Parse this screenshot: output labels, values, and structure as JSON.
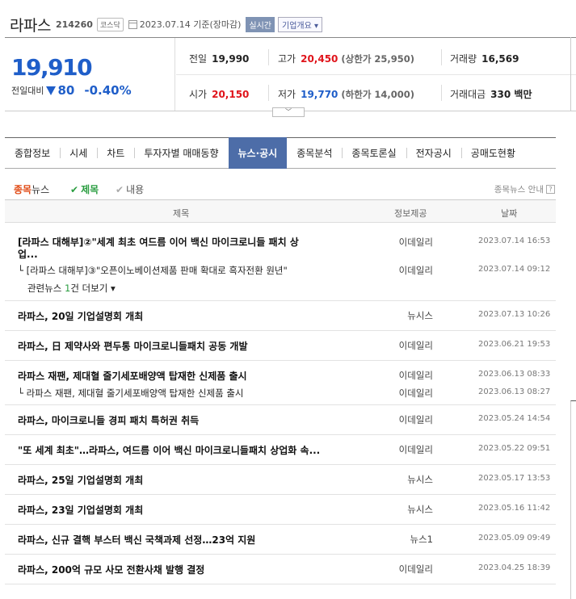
{
  "header": {
    "name": "라파스",
    "code": "214260",
    "market": "코스닥",
    "date": "2023.07.14 기준(장마감)",
    "realtime": "실시간",
    "overview": "기업개요 ▾"
  },
  "price": {
    "current": "19,910",
    "diff_label": "전일대비",
    "diff_amount": "80",
    "diff_pct": "-0.40%",
    "stats": {
      "prev_label": "전일",
      "prev": "19,990",
      "high_label": "고가",
      "high": "20,450",
      "upper_limit": "(상한가 25,950)",
      "volume_label": "거래량",
      "volume": "16,569",
      "open_label": "시가",
      "open": "20,150",
      "low_label": "저가",
      "low": "19,770",
      "lower_limit": "(하한가 14,000)",
      "amount_label": "거래대금",
      "amount": "330 백만"
    }
  },
  "tabs": [
    "종합정보",
    "시세",
    "차트",
    "투자자별 매매동향",
    "뉴스·공시",
    "종목분석",
    "종목토론실",
    "전자공시",
    "공매도현황"
  ],
  "subbar": {
    "title_o": "종목",
    "title_n": "뉴스",
    "check_title": "제목",
    "check_content": "내용",
    "guide": "종목뉴스 안내",
    "q": "?"
  },
  "table": {
    "headers": {
      "title": "제목",
      "source": "정보제공",
      "date": "날짜"
    },
    "rows": [
      {
        "title": "[라파스 대해부]②\"세계 최초 여드름 이어 백신 마이크로니들 패치 상",
        "title2": "업...",
        "source": "이데일리",
        "date": "2023.07.14 16:53",
        "sub": "└ [라파스 대해부]③\"오픈이노베이션제품 판매 확대로 흑자전환 원년\"",
        "sub_source": "이데일리",
        "sub_date": "2023.07.14 09:12",
        "related_pre": "관련뉴스 ",
        "related_cnt": "1",
        "related_post": "건 더보기 ▾"
      },
      {
        "title": "라파스, 20일 기업설명회 개최",
        "source": "뉴시스",
        "date": "2023.07.13 10:26"
      },
      {
        "title": "라파스, 日 제약사와 편두통 마이크로니들패치 공동 개발",
        "source": "이데일리",
        "date": "2023.06.21 19:53"
      },
      {
        "title": "라파스 재팬, 제대혈 줄기세포배양액 탑재한 신제품 출시",
        "source": "이데일리",
        "date": "2023.06.13 08:33",
        "sub": "└ 라파스 재팬, 제대혈 줄기세포배양액 탑재한 신제품 출시",
        "sub_source": "이데일리",
        "sub_date": "2023.06.13 08:27"
      },
      {
        "title": "라파스, 마이크로니들 경피 패치 특허권 취득",
        "source": "이데일리",
        "date": "2023.05.24 14:54"
      },
      {
        "title": "\"또 세계 최초\"…라파스, 여드름 이어 백신 마이크로니들패치 상업화 속...",
        "source": "이데일리",
        "date": "2023.05.22 09:51"
      },
      {
        "title": "라파스, 25일 기업설명회 개최",
        "source": "뉴시스",
        "date": "2023.05.17 13:53"
      },
      {
        "title": "라파스, 23일 기업설명회 개최",
        "source": "뉴시스",
        "date": "2023.05.16 11:42"
      },
      {
        "title": "라파스, 신규 결핵 부스터 백신 국책과제 선정…23억 지원",
        "source": "뉴스1",
        "date": "2023.05.09 09:49"
      },
      {
        "title": "라파스, 200억 규모 사모 전환사채 발행 결정",
        "source": "이데일리",
        "date": "2023.04.25 18:39"
      }
    ]
  }
}
